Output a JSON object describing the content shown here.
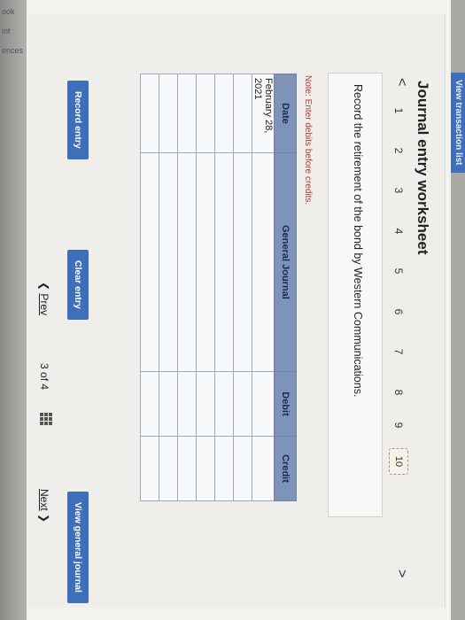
{
  "top_tab": "View transaction list",
  "side_labels": [
    "ook",
    "int",
    "ences"
  ],
  "title": "Journal entry worksheet",
  "steps": [
    "1",
    "2",
    "3",
    "4",
    "5",
    "6",
    "7",
    "8",
    "9",
    "10"
  ],
  "active_step": "10",
  "prev_chevron": "<",
  "next_chevron": ">",
  "instruction": "Record the retirement of the bond by Western Communications.",
  "note": "Note: Enter debits before credits.",
  "table": {
    "headers": [
      "Date",
      "General Journal",
      "Debit",
      "Credit"
    ],
    "rows": [
      [
        "February 28, 2021",
        "",
        "",
        ""
      ],
      [
        "",
        "",
        "",
        ""
      ],
      [
        "",
        "",
        "",
        ""
      ],
      [
        "",
        "",
        "",
        ""
      ],
      [
        "",
        "",
        "",
        ""
      ],
      [
        "",
        "",
        "",
        ""
      ],
      [
        "",
        "",
        "",
        ""
      ]
    ]
  },
  "buttons": {
    "record": "Record entry",
    "clear": "Clear entry",
    "view_journal": "View general journal"
  },
  "pager": {
    "prev": "Prev",
    "page": "3",
    "of_label": "of",
    "total": "4",
    "next": "Next"
  },
  "colors": {
    "accent": "#3f6fb8",
    "table_header": "#7f93b8",
    "note": "#b53a2f"
  }
}
